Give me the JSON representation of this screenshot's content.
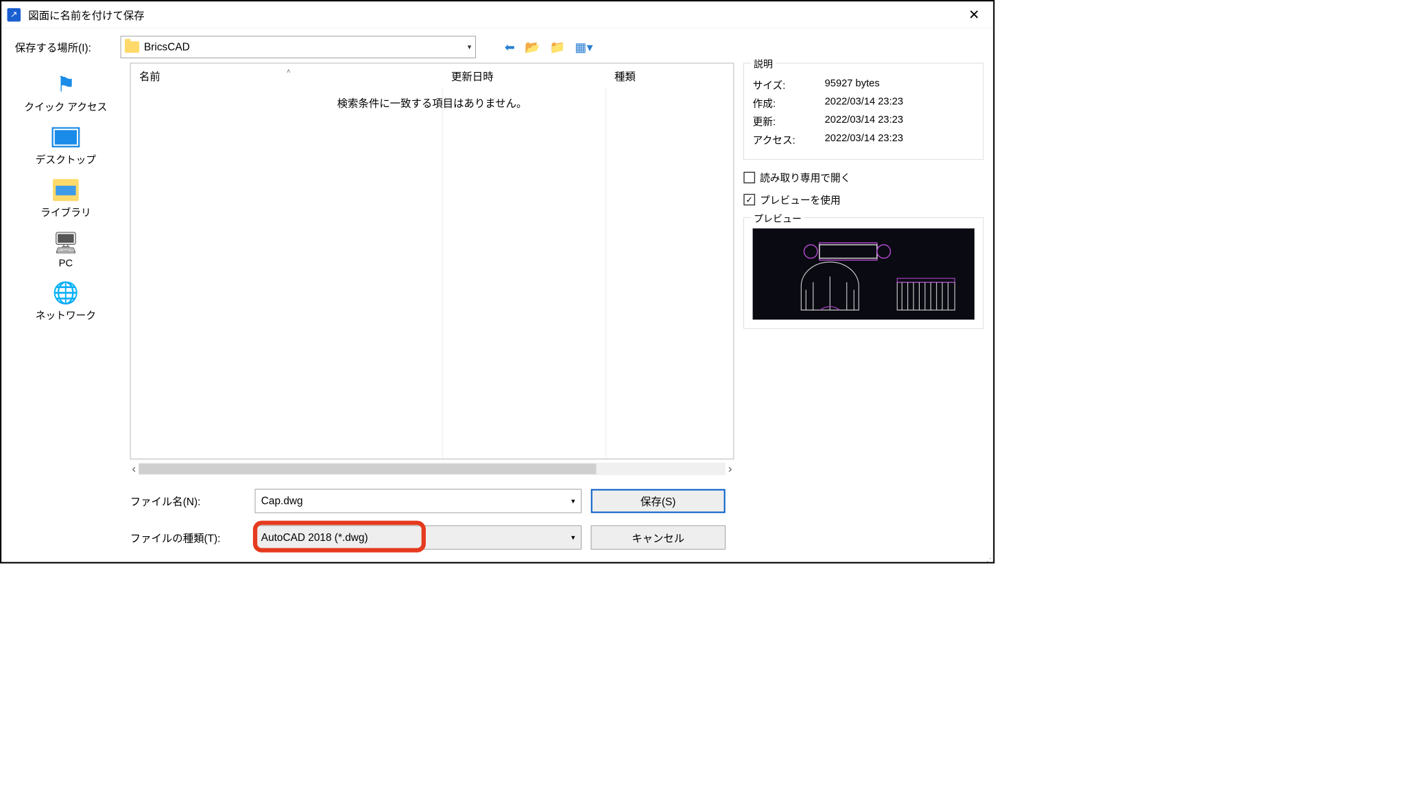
{
  "titlebar": {
    "title": "図面に名前を付けて保存"
  },
  "location": {
    "label": "保存する場所(I):",
    "value": "BricsCAD"
  },
  "toolbar_icons": {
    "back": "back-icon",
    "up": "up-folder-icon",
    "new_folder": "new-folder-icon",
    "view": "view-menu-icon"
  },
  "places": [
    {
      "label": "クイック アクセス",
      "icon": "quick-access-icon"
    },
    {
      "label": "デスクトップ",
      "icon": "desktop-icon"
    },
    {
      "label": "ライブラリ",
      "icon": "library-icon"
    },
    {
      "label": "PC",
      "icon": "pc-icon"
    },
    {
      "label": "ネットワーク",
      "icon": "network-icon"
    }
  ],
  "columns": {
    "name": "名前",
    "date": "更新日時",
    "type": "種類"
  },
  "empty_message": "検索条件に一致する項目はありません。",
  "form": {
    "filename_label": "ファイル名(N):",
    "filename_value": "Cap.dwg",
    "filetype_label": "ファイルの種類(T):",
    "filetype_value": "AutoCAD 2018 (*.dwg)",
    "save_label": "保存(S)",
    "cancel_label": "キャンセル"
  },
  "sidepanel": {
    "description_legend": "説明",
    "rows": {
      "size_k": "サイズ:",
      "size_v": "95927 bytes",
      "created_k": "作成:",
      "created_v": "2022/03/14 23:23",
      "updated_k": "更新:",
      "updated_v": "2022/03/14 23:23",
      "access_k": "アクセス:",
      "access_v": "2022/03/14 23:23"
    },
    "readonly_label": "読み取り専用で開く",
    "readonly_checked": false,
    "use_preview_label": "プレビューを使用",
    "use_preview_checked": true,
    "preview_legend": "プレビュー"
  }
}
